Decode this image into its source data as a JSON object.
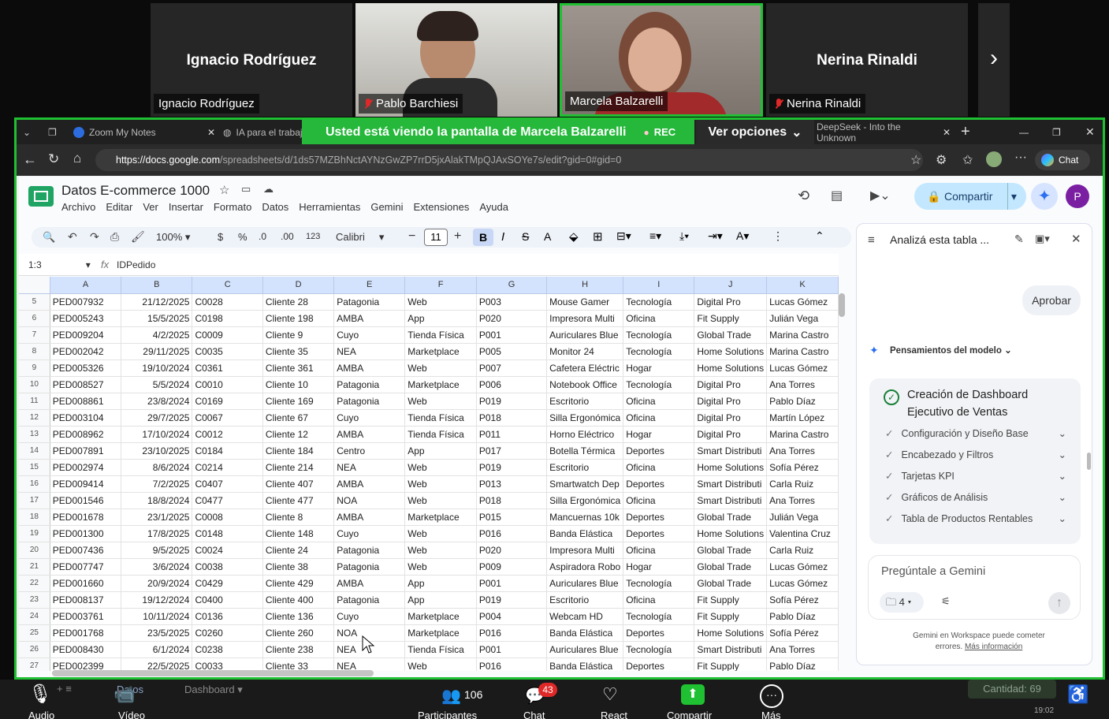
{
  "participants": [
    {
      "big": "Ignacio Rodríguez",
      "tag": "Ignacio Rodríguez",
      "muted": false
    },
    {
      "big": "",
      "tag": "Pablo Barchiesi",
      "muted": true
    },
    {
      "big": "",
      "tag": "Marcela Balzarelli",
      "muted": false
    },
    {
      "big": "Nerina Rinaldi",
      "tag": "Nerina Rinaldi",
      "muted": true
    }
  ],
  "browser": {
    "tab1": "Zoom My Notes",
    "tab2": "IA para el trabajo",
    "tab3": "DeepSeek - Into the Unknown",
    "banner": "Usted está viendo la pantalla de  Marcela Balzarelli",
    "rec": "REC",
    "options": "Ver opciones",
    "url_host": "https://docs.google.com",
    "url_path": "/spreadsheets/d/1ds57MZBhNctAYNzGwZP7rrD5jxAlakTMpQJAxSOYe7s/edit?gid=0#gid=0",
    "chat": "Chat"
  },
  "sheet": {
    "title": "Datos E-commerce 1000",
    "menus": [
      "Archivo",
      "Editar",
      "Ver",
      "Insertar",
      "Formato",
      "Datos",
      "Herramientas",
      "Gemini",
      "Extensiones",
      "Ayuda"
    ],
    "share": "Compartir",
    "zoom": "100%",
    "currency": "$",
    "percent": "%",
    "dec_less": ".0",
    "dec_more": ".00",
    "num_fmt": "123",
    "font": "Calibri",
    "font_size": "11",
    "cell_ref": "1:3",
    "formula": "IDPedido",
    "columns": [
      "A",
      "B",
      "C",
      "D",
      "E",
      "F",
      "G",
      "H",
      "I",
      "J",
      "K"
    ],
    "rows": [
      [
        "5",
        "PED007932",
        "21/12/2025",
        "C0028",
        "Cliente 28",
        "Patagonia",
        "Web",
        "P003",
        "Mouse Gamer",
        "Tecnología",
        "Digital Pro",
        "Lucas Gómez"
      ],
      [
        "6",
        "PED005243",
        "15/5/2025",
        "C0198",
        "Cliente 198",
        "AMBA",
        "App",
        "P020",
        "Impresora Multi",
        "Oficina",
        "Fit Supply",
        "Julián Vega"
      ],
      [
        "7",
        "PED009204",
        "4/2/2025",
        "C0009",
        "Cliente 9",
        "Cuyo",
        "Tienda Física",
        "P001",
        "Auriculares Blue",
        "Tecnología",
        "Global Trade",
        "Marina Castro"
      ],
      [
        "8",
        "PED002042",
        "29/11/2025",
        "C0035",
        "Cliente 35",
        "NEA",
        "Marketplace",
        "P005",
        "Monitor 24",
        "Tecnología",
        "Home Solutions",
        "Marina Castro"
      ],
      [
        "9",
        "PED005326",
        "19/10/2024",
        "C0361",
        "Cliente 361",
        "AMBA",
        "Web",
        "P007",
        "Cafetera Eléctric",
        "Hogar",
        "Home Solutions",
        "Lucas Gómez"
      ],
      [
        "10",
        "PED008527",
        "5/5/2024",
        "C0010",
        "Cliente 10",
        "Patagonia",
        "Marketplace",
        "P006",
        "Notebook Office",
        "Tecnología",
        "Digital Pro",
        "Ana Torres"
      ],
      [
        "11",
        "PED008861",
        "23/8/2024",
        "C0169",
        "Cliente 169",
        "Patagonia",
        "Web",
        "P019",
        "Escritorio",
        "Oficina",
        "Digital Pro",
        "Pablo Díaz"
      ],
      [
        "12",
        "PED003104",
        "29/7/2025",
        "C0067",
        "Cliente 67",
        "Cuyo",
        "Tienda Física",
        "P018",
        "Silla Ergonómica",
        "Oficina",
        "Digital Pro",
        "Martín López"
      ],
      [
        "13",
        "PED008962",
        "17/10/2024",
        "C0012",
        "Cliente 12",
        "AMBA",
        "Tienda Física",
        "P011",
        "Horno Eléctrico",
        "Hogar",
        "Digital Pro",
        "Marina Castro"
      ],
      [
        "14",
        "PED007891",
        "23/10/2025",
        "C0184",
        "Cliente 184",
        "Centro",
        "App",
        "P017",
        "Botella Térmica",
        "Deportes",
        "Smart Distributi",
        "Ana Torres"
      ],
      [
        "15",
        "PED002974",
        "8/6/2024",
        "C0214",
        "Cliente 214",
        "NEA",
        "Web",
        "P019",
        "Escritorio",
        "Oficina",
        "Home Solutions",
        "Sofía Pérez"
      ],
      [
        "16",
        "PED009414",
        "7/2/2025",
        "C0407",
        "Cliente 407",
        "AMBA",
        "Web",
        "P013",
        "Smartwatch Dep",
        "Deportes",
        "Smart Distributi",
        "Carla Ruiz"
      ],
      [
        "17",
        "PED001546",
        "18/8/2024",
        "C0477",
        "Cliente 477",
        "NOA",
        "Web",
        "P018",
        "Silla Ergonómica",
        "Oficina",
        "Smart Distributi",
        "Ana Torres"
      ],
      [
        "18",
        "PED001678",
        "23/1/2025",
        "C0008",
        "Cliente 8",
        "AMBA",
        "Marketplace",
        "P015",
        "Mancuernas 10k",
        "Deportes",
        "Global Trade",
        "Julián Vega"
      ],
      [
        "19",
        "PED001300",
        "17/8/2025",
        "C0148",
        "Cliente 148",
        "Cuyo",
        "Web",
        "P016",
        "Banda Elástica",
        "Deportes",
        "Home Solutions",
        "Valentina Cruz"
      ],
      [
        "20",
        "PED007436",
        "9/5/2025",
        "C0024",
        "Cliente 24",
        "Patagonia",
        "Web",
        "P020",
        "Impresora Multi",
        "Oficina",
        "Global Trade",
        "Carla Ruiz"
      ],
      [
        "21",
        "PED007747",
        "3/6/2024",
        "C0038",
        "Cliente 38",
        "Patagonia",
        "Web",
        "P009",
        "Aspiradora Robo",
        "Hogar",
        "Global Trade",
        "Lucas Gómez"
      ],
      [
        "22",
        "PED001660",
        "20/9/2024",
        "C0429",
        "Cliente 429",
        "AMBA",
        "App",
        "P001",
        "Auriculares Blue",
        "Tecnología",
        "Global Trade",
        "Lucas Gómez"
      ],
      [
        "23",
        "PED008137",
        "19/12/2024",
        "C0400",
        "Cliente 400",
        "Patagonia",
        "App",
        "P019",
        "Escritorio",
        "Oficina",
        "Fit Supply",
        "Sofía Pérez"
      ],
      [
        "24",
        "PED003761",
        "10/11/2024",
        "C0136",
        "Cliente 136",
        "Cuyo",
        "Marketplace",
        "P004",
        "Webcam HD",
        "Tecnología",
        "Fit Supply",
        "Pablo Díaz"
      ],
      [
        "25",
        "PED001768",
        "23/5/2025",
        "C0260",
        "Cliente 260",
        "NOA",
        "Marketplace",
        "P016",
        "Banda Elástica",
        "Deportes",
        "Home Solutions",
        "Sofía Pérez"
      ],
      [
        "26",
        "PED008430",
        "6/1/2024",
        "C0238",
        "Cliente 238",
        "NEA",
        "Tienda Física",
        "P001",
        "Auriculares Blue",
        "Tecnología",
        "Smart Distributi",
        "Ana Torres"
      ],
      [
        "27",
        "PED002399",
        "22/5/2025",
        "C0033",
        "Cliente 33",
        "NEA",
        "Web",
        "P016",
        "Banda Elástica",
        "Deportes",
        "Fit Supply",
        "Pablo Díaz"
      ]
    ],
    "sheet_tab1": "Datos",
    "sheet_tab2": "Dashboard",
    "count": "Cantidad: 69"
  },
  "gemini": {
    "title": "Analizá esta tabla ...",
    "approve": "Aprobar",
    "thoughts": "Pensamientos del modelo",
    "task_title": "Creación de Dashboard Ejecutivo de Ventas",
    "steps": [
      "Configuración y Diseño Base",
      "Encabezado y Filtros",
      "Tarjetas KPI",
      "Gráficos de Análisis",
      "Tabla de Productos Rentables"
    ],
    "input_placeholder": "Pregúntale a Gemini",
    "sources": "4",
    "disclaimer": "Gemini en Workspace puede cometer errores.",
    "more_info": "Más información"
  },
  "zoombar": {
    "audio": "Audio",
    "video": "Vídeo",
    "participants_count": "106",
    "participants": "Participantes",
    "chat_badge": "43",
    "chat": "Chat",
    "react": "React",
    "share": "Compartir",
    "more": "Más",
    "time": "19:02"
  }
}
